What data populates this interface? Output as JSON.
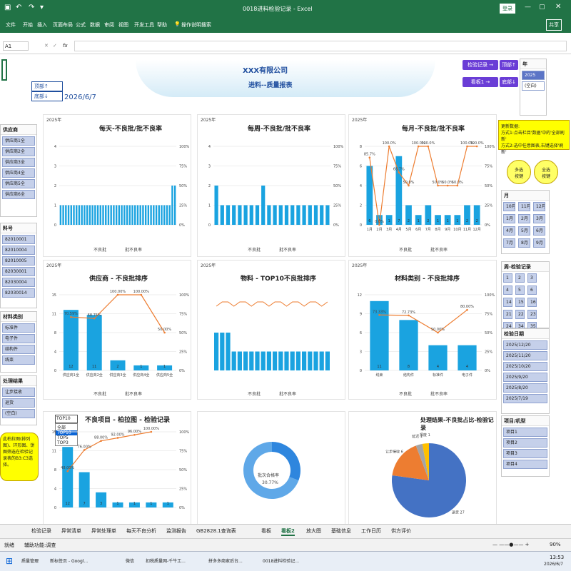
{
  "window": {
    "title": "0018进料检验记录 - Excel",
    "signin": "登录",
    "share": "共享"
  },
  "ribbon": [
    "文件",
    "开始",
    "插入",
    "页面布局",
    "公式",
    "数据",
    "审阅",
    "视图",
    "开发工具",
    "帮助",
    "操作说明搜索"
  ],
  "formula": {
    "cell": "A1",
    "fx": "fx"
  },
  "header": {
    "company": "XXX有限公司",
    "report": "进料--质量报表",
    "date": "2026/6/7",
    "top_btn": "顶部↑",
    "bottom_btn": "底部↓"
  },
  "nav": {
    "record": "检验记录 →",
    "board1": "看板1 →",
    "top": "顶部↑",
    "bottom": "底部↓"
  },
  "year": {
    "title": "年",
    "items": [
      "2025",
      "(空白)"
    ]
  },
  "note_right": "更新数据:\n方式1:点击栏目'数据'中的'全部刷新'\n方式2:选中任意图表,右键选择'刷新'",
  "bubble_multi": "多选\n按键",
  "bubble_clear": "全选\n按键",
  "bubble_left": "此柏拉图(排列图)、环形图、饼图筛选在检验记录表的B3:C3选择。",
  "supplier_slicer": {
    "title": "供应商",
    "items": [
      "供应商1全",
      "供应商2全",
      "供应商3全",
      "供应商4全",
      "供应商5全",
      "供应商6全"
    ]
  },
  "material_slicer": {
    "title": "料号",
    "items": [
      "82010001",
      "82010004",
      "82010005",
      "82030001",
      "82030004",
      "82030014"
    ]
  },
  "category_slicer": {
    "title": "材料类别",
    "items": [
      "标准件",
      "电子件",
      "结构件",
      "线束"
    ]
  },
  "process_slicer": {
    "title": "处理结果",
    "items": [
      "让步接收",
      "退货",
      "(空白)"
    ]
  },
  "month_slicer": {
    "title": "月",
    "items": [
      "10月",
      "11月",
      "12月",
      "1月",
      "2月",
      "3月",
      "4月",
      "5月",
      "6月",
      "7月",
      "8月",
      "9月"
    ]
  },
  "week_slicer": {
    "title": "周-检验记录",
    "items": [
      "1",
      "2",
      "3",
      "4",
      "5",
      "6",
      "14",
      "15",
      "16",
      "21",
      "22",
      "23",
      "24",
      "34",
      "35"
    ]
  },
  "date_slicer": {
    "title": "检验日期",
    "items": [
      "2025/12/20",
      "2025/11/20",
      "2025/10/20",
      "2025/9/20",
      "2025/8/20",
      "2025/7/19"
    ]
  },
  "project_slicer": {
    "title": "项目/机型",
    "items": [
      "项目1",
      "项目2",
      "项目3",
      "项目4"
    ]
  },
  "charts": {
    "c1": {
      "title": "每天-不良批/批不良率",
      "year": "2025年",
      "legend": [
        "不良批",
        "批不良率"
      ]
    },
    "c2": {
      "title": "每周-不良批/批不良率",
      "year": "2025年",
      "legend": [
        "不良批",
        "批不良率"
      ]
    },
    "c3": {
      "title": "每月-不良批/批不良率",
      "year": "2025年",
      "legend": [
        "不良批",
        "批不良率"
      ]
    },
    "c4": {
      "title": "供应商 - 不良批排序",
      "year": "2025年",
      "legend": [
        "不良批",
        "批不良率"
      ]
    },
    "c5": {
      "title": "物料 - TOP10不良批排序",
      "year": "2025年",
      "legend": [
        "不良批",
        "批不良率"
      ]
    },
    "c6": {
      "title": "材料类别 - 不良批排序",
      "year": "2025年",
      "legend": [
        "不良批",
        "批不良率"
      ]
    },
    "c7": {
      "title": "不良项目 - 柏拉图 - 检验记录",
      "dropdown": [
        "TOP10",
        "全部",
        "TOP10",
        "TOP5",
        "TOP3"
      ]
    },
    "c8": {
      "center": "批次合格率",
      "value": "30.77%"
    },
    "c9": {
      "title": "处理结果-不良批占比-检验记录",
      "labels": [
        "延迟",
        "让步接收",
        "报废",
        "退货"
      ]
    }
  },
  "chart_data": [
    {
      "type": "bar",
      "title": "每天-不良批/批不良率",
      "values": [
        1,
        1,
        1,
        1,
        1,
        1,
        1,
        1,
        1,
        1,
        1,
        1,
        1,
        1,
        1,
        1,
        1,
        1,
        1,
        1,
        1,
        1,
        1,
        1,
        1,
        1,
        1,
        1,
        1,
        1,
        1,
        1,
        1,
        1,
        1,
        1,
        1,
        1,
        1,
        1,
        1,
        1,
        2,
        2
      ],
      "ylim": [
        0,
        4
      ],
      "y2lim": [
        0,
        100
      ]
    },
    {
      "type": "bar",
      "title": "每周-不良批/批不良率",
      "values": [
        2,
        1,
        1,
        1,
        1,
        1,
        1,
        1,
        2,
        1,
        1,
        1,
        1,
        1,
        1,
        1,
        1,
        1,
        1,
        1
      ],
      "ylim": [
        0,
        4
      ]
    },
    {
      "type": "bar",
      "title": "每月-不良批/批不良率",
      "categories": [
        "1月",
        "2月",
        "3月",
        "4月",
        "5月",
        "6月",
        "7月",
        "8月",
        "9月",
        "10月",
        "11月",
        "12月"
      ],
      "values": [
        6,
        1,
        1,
        7,
        2,
        1,
        2,
        1,
        1,
        1,
        2,
        2
      ],
      "rates": [
        85.7,
        0,
        100,
        66.7,
        50,
        100,
        100,
        50,
        50,
        50,
        100,
        100
      ]
    },
    {
      "type": "bar",
      "title": "供应商 - 不良批排序",
      "categories": [
        "供应商1全",
        "供应商2全",
        "供应商3全",
        "供应商4全",
        "供应商5全"
      ],
      "values": [
        12,
        11,
        2,
        1,
        1
      ],
      "rates": [
        70.59,
        68.75,
        100,
        100,
        50
      ]
    },
    {
      "type": "bar",
      "title": "材料类别 - 不良批排序",
      "categories": [
        "线束",
        "结构件",
        "标准件",
        "电子件"
      ],
      "values": [
        11,
        8,
        4,
        4
      ],
      "rates": [
        73.33,
        72.73,
        50,
        80
      ]
    },
    {
      "type": "bar",
      "title": "不良项目 - 柏拉图 - 检验记录",
      "values": [
        12,
        7,
        3,
        1,
        1,
        1,
        1
      ],
      "rates": [
        48,
        76,
        88,
        92,
        96,
        100
      ]
    },
    {
      "type": "pie",
      "categories": [
        "合格",
        "不合格"
      ],
      "values": [
        30.77,
        69.23
      ]
    },
    {
      "type": "pie",
      "categories": [
        "退货",
        "让步接收",
        "延迟",
        "报废"
      ],
      "values": [
        27,
        6,
        1,
        1
      ]
    }
  ],
  "tabs": [
    "检验记录",
    "异常清单",
    "异常处理单",
    "每天不良分析",
    "监测报告",
    "GB2828.1查询表",
    "看板",
    "看板2",
    "放大图",
    "基础信息",
    "工作日历",
    "供方评价"
  ],
  "status": {
    "left": "就绪",
    "access": "辅助功能:调查",
    "zoom": "90%"
  },
  "taskbar": {
    "apps": [
      "质量管理",
      "新标签页 - Googl...",
      "微信",
      "扣税质量网-千牛工...",
      "拼多多商家后台...",
      "0018进料检验记..."
    ],
    "time": "13:53",
    "date": "2026/6/7"
  },
  "colors": {
    "excel": "#217346",
    "bar": "#1aa3e0",
    "line": "#ed7d31",
    "purple": "#6a3dd6"
  }
}
